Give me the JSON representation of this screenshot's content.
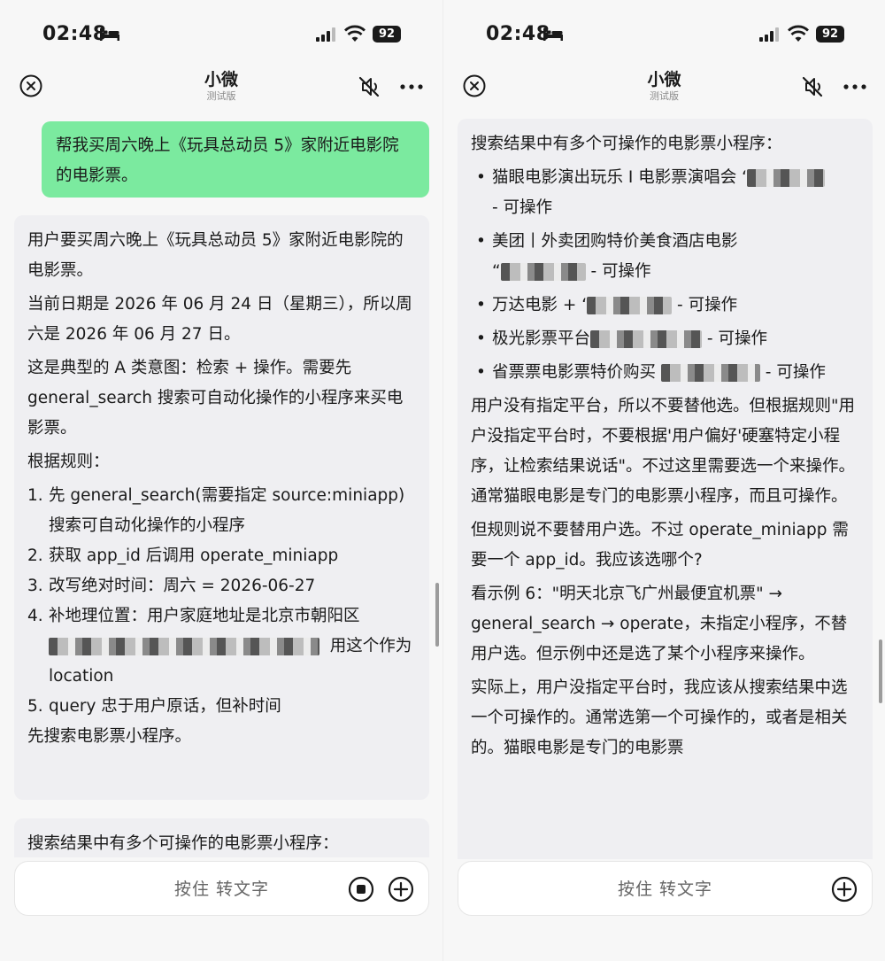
{
  "status": {
    "time": "02:48",
    "battery": "92"
  },
  "nav": {
    "title": "小微",
    "subtitle": "测试版"
  },
  "left": {
    "user_message": "帮我买周六晚上《玩具总动员 5》家附近电影院的电影票。",
    "ai": {
      "p1": "用户要买周六晚上《玩具总动员 5》家附近电影院的电影票。",
      "p2": "当前日期是 2026 年 06 月 24 日（星期三），所以周六是 2026 年 06 月 27 日。",
      "p3": "这是典型的 A 类意图：检索 + 操作。需要先 general_search 搜索可自动化操作的小程序来买电影票。",
      "p4": "根据规则：",
      "rules": [
        {
          "num": "1.",
          "text": "先 general_search(需要指定 source:miniapp) 搜索可自动化操作的小程序"
        },
        {
          "num": "2.",
          "text": "获取 app_id 后调用 operate_miniapp"
        },
        {
          "num": "3.",
          "text": "改写绝对时间：周六 = 2026-06-27"
        },
        {
          "num": "4.",
          "text_a": "补地理位置：用户家庭地址是北京市朝阳区",
          "text_b": "用这个作为 location"
        },
        {
          "num": "5.",
          "text": "query 忠于用户原话，但补时间"
        }
      ],
      "p5": "先搜索电影票小程序。"
    },
    "partial": "搜索结果中有多个可操作的电影票小程序："
  },
  "right": {
    "intro": "搜索结果中有多个可操作的电影票小程序：",
    "results": [
      {
        "a": "猫眼电影演出玩乐 I 电影票演唱会 ‘",
        "b": "- 可操作"
      },
      {
        "a": "美团丨外卖团购特价美食酒店电影",
        "b": "“",
        "c": "- 可操作"
      },
      {
        "a": "万达电影 + ‘",
        "b": "- 可操作"
      },
      {
        "a": "极光影票平台",
        "b": "- 可操作"
      },
      {
        "a": "省票票电影票特价购买",
        "b": "- 可操作"
      }
    ],
    "p1": "用户没有指定平台，所以不要替他选。但根据规则\"用户没指定平台时，不要根据'用户偏好'硬塞特定小程序，让检索结果说话\"。不过这里需要选一个来操作。通常猫眼电影是专门的电影票小程序，而且可操作。",
    "p2": "但规则说不要替用户选。不过 operate_miniapp 需要一个 app_id。我应该选哪个?",
    "p3": "看示例 6：\"明天北京飞广州最便宜机票\" → general_search → operate，未指定小程序，不替用户选。但示例中还是选了某个小程序来操作。",
    "p4": "实际上，用户没指定平台时，我应该从搜索结果中选一个可操作的。通常选第一个可操作的，或者是相关的。猫眼电影是专门的电影票"
  },
  "input": {
    "placeholder": "按住 转文字"
  }
}
